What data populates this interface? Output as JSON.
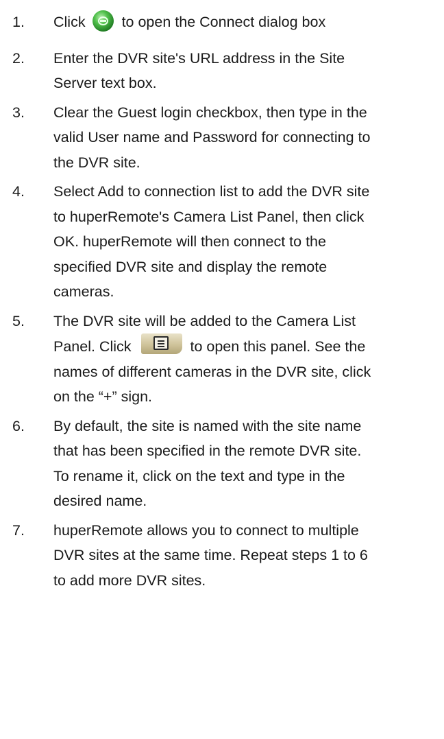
{
  "steps": [
    {
      "number": "1.",
      "before_icon": "Click",
      "icon": "connect-icon",
      "after_icon": "to open the Connect dialog box"
    },
    {
      "number": "2.",
      "lines": [
        "Enter the DVR site's URL address in the Site",
        "Server text box."
      ]
    },
    {
      "number": "3.",
      "lines": [
        "Clear the Guest login checkbox, then type in the",
        "valid User name and Password for connecting to",
        "the DVR site."
      ]
    },
    {
      "number": "4.",
      "lines": [
        "Select Add to connection list to add the DVR site",
        "to huperRemote's Camera List Panel, then click",
        "OK. huperRemote will then connect to the",
        "specified DVR site and display the remote",
        "cameras."
      ]
    },
    {
      "number": "5.",
      "line1": "The DVR site will be added to the Camera List",
      "line2_before_icon": "Panel. Click",
      "icon": "camera-list-panel-icon",
      "line2_after_icon": "to open this panel. See the",
      "line3": "names of different cameras in the DVR site, click",
      "line4": "on the “+” sign."
    },
    {
      "number": "6.",
      "lines": [
        "By default, the site is named with the site name",
        "that has been specified in the remote DVR site.",
        "To rename it, click on the text and type in the",
        "desired name."
      ]
    },
    {
      "number": "7.",
      "lines": [
        "huperRemote allows you to connect to multiple",
        "DVR sites at the same time. Repeat steps 1 to 6",
        "to add more DVR sites."
      ]
    }
  ]
}
